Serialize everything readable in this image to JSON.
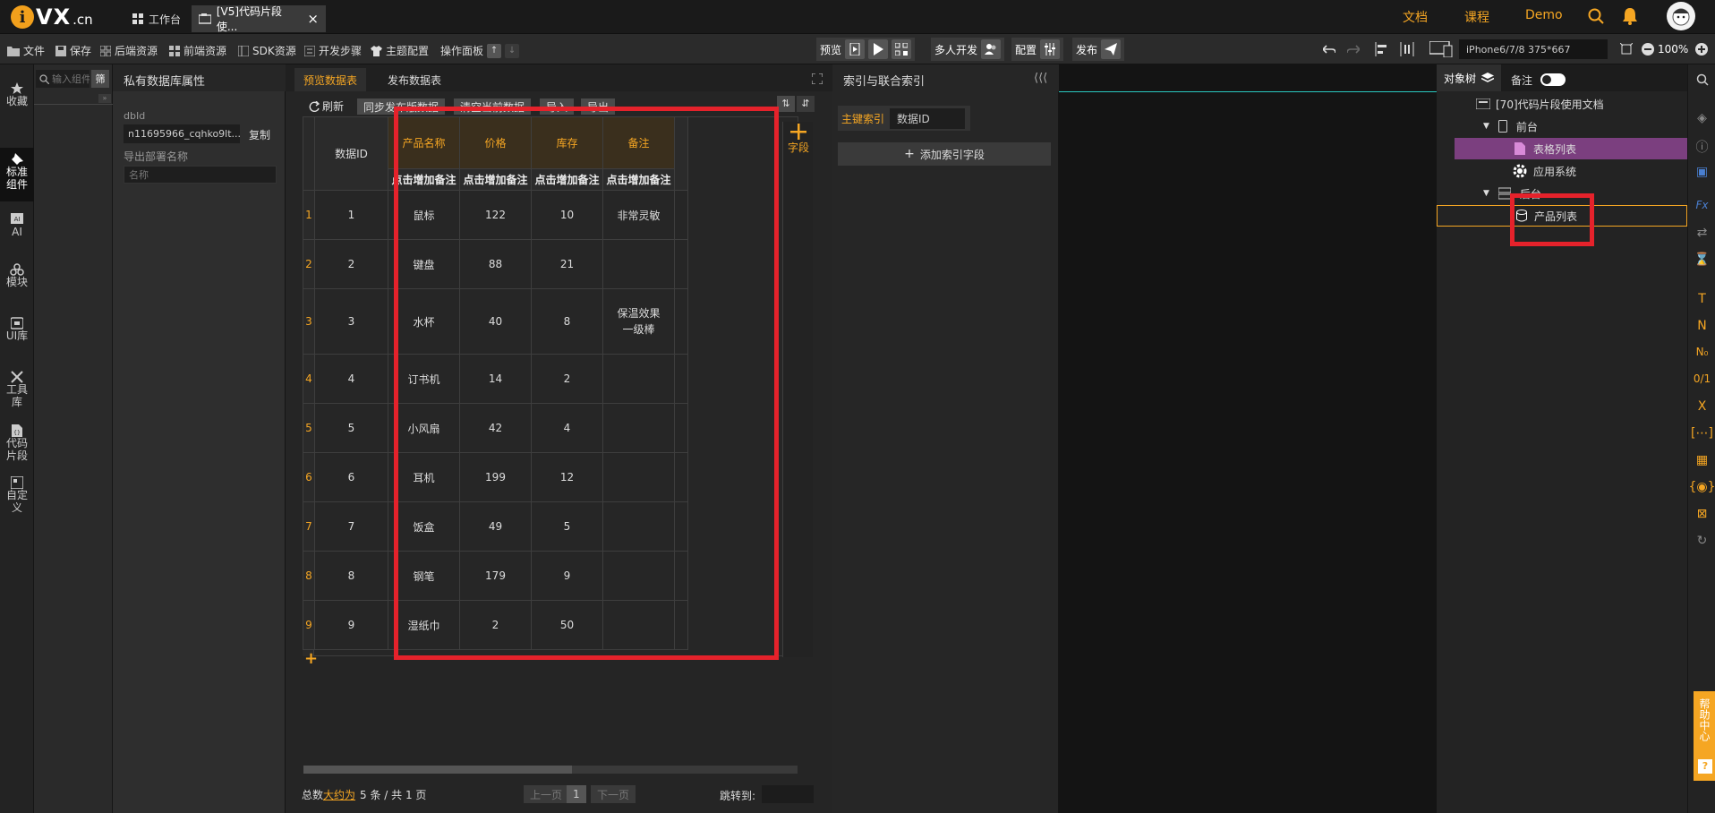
{
  "topbar": {
    "logo_letter": "i",
    "logo_name": "VX",
    "logo_tld": ".cn",
    "tab1": "工作台",
    "tab2": "[V5]代码片段使...",
    "tab2_close": "×",
    "link_docs": "文档",
    "link_course": "课程",
    "link_demo": "Demo"
  },
  "toolbar": {
    "file": "文件",
    "save": "保存",
    "backend_res": "后端资源",
    "frontend_res": "前端资源",
    "sdk_res": "SDK资源",
    "dev_steps": "开发步骤",
    "theme": "主题配置",
    "ops_panel": "操作面板",
    "preview": "预览",
    "multi_dev": "多人开发",
    "config": "配置",
    "publish": "发布",
    "device": "iPhone6/7/8 375*667",
    "zoom": "100%"
  },
  "rail": {
    "items": [
      {
        "label": "收藏"
      },
      {
        "label": "标准组件"
      },
      {
        "label": "AI"
      },
      {
        "label": "模块"
      },
      {
        "label": "UI库"
      },
      {
        "label": "工具库"
      },
      {
        "label": "代码片段"
      },
      {
        "label": "自定义"
      }
    ]
  },
  "compsearch": {
    "placeholder": "输入组件名称",
    "filter": "筛"
  },
  "props": {
    "title": "私有数据库属性",
    "dbid_label": "dbId",
    "dbid_value": "n11695966_cqhko9lt...",
    "copy": "复制",
    "export_label": "导出部署名称",
    "export_placeholder": "名称"
  },
  "center": {
    "tab_preview": "预览数据表",
    "tab_publish": "发布数据表",
    "refresh": "刷新",
    "sync": "同步发布版数据",
    "clear": "清空当前数据",
    "import": "导入",
    "export": "导出",
    "add_field": "字段",
    "header_id": "数据ID",
    "add_note": "点击增加备注",
    "add_row": "+",
    "columns": [
      "产品名称",
      "价格",
      "库存",
      "备注"
    ],
    "rows": [
      {
        "n": "1",
        "id": "1",
        "name": "鼠标",
        "price": "122",
        "stock": "10",
        "note": "非常灵敏"
      },
      {
        "n": "2",
        "id": "2",
        "name": "键盘",
        "price": "88",
        "stock": "21",
        "note": ""
      },
      {
        "n": "3",
        "id": "3",
        "name": "水杯",
        "price": "40",
        "stock": "8",
        "note": "保温效果一级棒"
      },
      {
        "n": "4",
        "id": "4",
        "name": "订书机",
        "price": "14",
        "stock": "2",
        "note": ""
      },
      {
        "n": "5",
        "id": "5",
        "name": "小风扇",
        "price": "42",
        "stock": "4",
        "note": ""
      },
      {
        "n": "6",
        "id": "6",
        "name": "耳机",
        "price": "199",
        "stock": "12",
        "note": ""
      },
      {
        "n": "7",
        "id": "7",
        "name": "饭盒",
        "price": "49",
        "stock": "5",
        "note": ""
      },
      {
        "n": "8",
        "id": "8",
        "name": "钢笔",
        "price": "179",
        "stock": "9",
        "note": ""
      },
      {
        "n": "9",
        "id": "9",
        "name": "湿纸巾",
        "price": "2",
        "stock": "50",
        "note": ""
      }
    ],
    "footer": {
      "total_prefix": "总数",
      "total_link": "大约为",
      "total_count": "5 条 / 共 1 页",
      "prev": "上一页",
      "page": "1",
      "next": "下一页",
      "goto": "跳转到:"
    }
  },
  "index": {
    "title": "索引与联合索引",
    "primary_label": "主键索引",
    "primary_value": "数据ID",
    "add": "添加索引字段"
  },
  "tree": {
    "tab_objects": "对象树",
    "tab_notes": "备注",
    "root": "[70]代码片段使用文档",
    "front": "前台",
    "table_list": "表格列表",
    "app_system": "应用系统",
    "back": "后台",
    "product_list": "产品列表"
  },
  "help": {
    "label": "帮助中心",
    "q": "?"
  },
  "rrail": {
    "t": "T",
    "n": "N",
    "no": "N₀",
    "frac": "0/1",
    "x": "X"
  },
  "colors": {
    "accent": "#f5a623",
    "highlight": "#e5222b",
    "selected": "#7b3f7f"
  }
}
